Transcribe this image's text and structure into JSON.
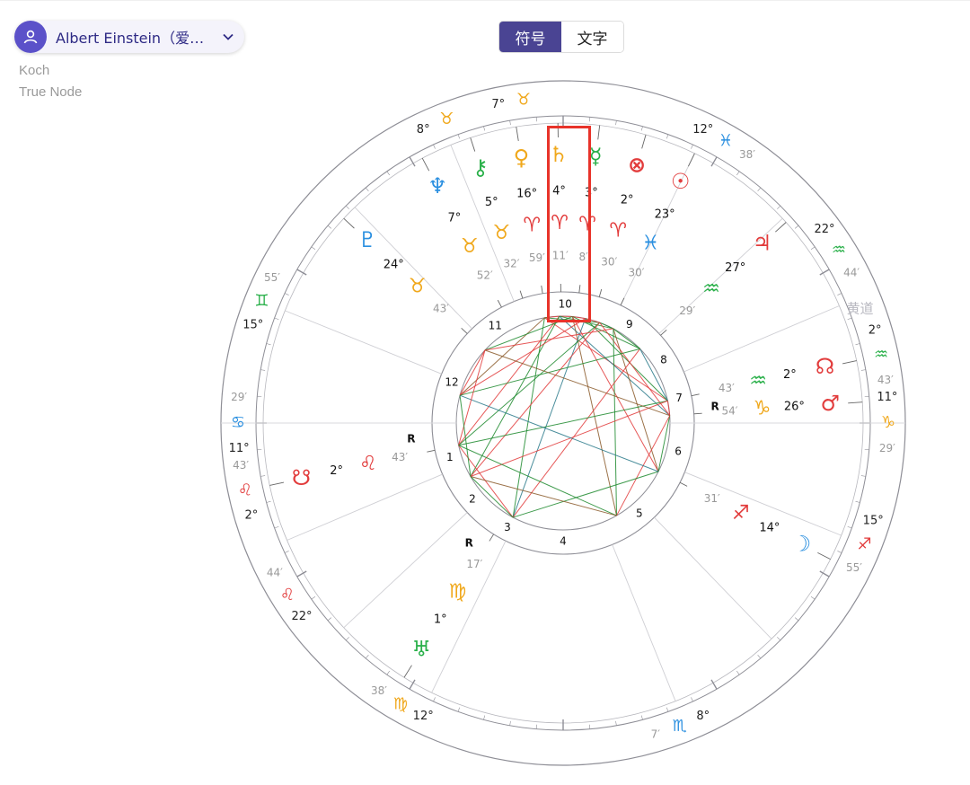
{
  "header": {
    "person_name": "Albert Einstein（爱因…",
    "house_system": "Koch",
    "node_type": "True Node",
    "tabs": [
      {
        "label": "符号",
        "active": true
      },
      {
        "label": "文字",
        "active": false
      }
    ]
  },
  "chart": {
    "ecliptic_label": "黄道",
    "outer_wheel": [
      {
        "deg": "7°",
        "min": "",
        "sign": "♉",
        "signColor": "#f0a81c",
        "ang": 97
      },
      {
        "deg": "12°",
        "min": "38′",
        "sign": "♓",
        "signColor": "#2a8fe0",
        "ang": 60
      },
      {
        "deg": "22°",
        "min": "44′",
        "sign": "♒",
        "signColor": "#2ab04a",
        "ang": 32
      },
      {
        "deg": "2°",
        "min": "43′",
        "sign": "♒",
        "signColor": "#2ab04a",
        "ang": 12
      },
      {
        "deg": "11°",
        "min": "29′",
        "sign": "♑",
        "signColor": "#f0a81c",
        "ang": 0
      },
      {
        "deg": "15°",
        "min": "55′",
        "sign": "♐",
        "signColor": "#e23c3c",
        "ang": -22
      },
      {
        "deg": "8°",
        "min": "7′",
        "sign": "♏",
        "signColor": "#2a8fe0",
        "ang": -69
      },
      {
        "deg": "12°",
        "min": "38′",
        "sign": "♍",
        "signColor": "#f0a81c",
        "ang": -120
      },
      {
        "deg": "22°",
        "min": "44′",
        "sign": "♌",
        "signColor": "#e23c3c",
        "ang": -148
      },
      {
        "deg": "2°",
        "min": "43′",
        "sign": "♌",
        "signColor": "#e23c3c",
        "ang": -168
      },
      {
        "deg": "11°",
        "min": "29′",
        "sign": "♋",
        "signColor": "#2a8fe0",
        "ang": -180
      },
      {
        "deg": "15°",
        "min": "55′",
        "sign": "♊",
        "signColor": "#2ab04a",
        "ang": 158
      },
      {
        "deg": "8°",
        "min": "",
        "sign": "♉",
        "signColor": "#f0a81c",
        "ang": 111
      }
    ],
    "planets": [
      {
        "name": "Neptune",
        "glyph": "♆",
        "color": "#2a8fe0",
        "deg": "7°",
        "sign": "♉",
        "signColor": "#f0a81c",
        "min": "52′",
        "ang": 118
      },
      {
        "name": "Chiron",
        "glyph": "⚷",
        "color": "#2ab04a",
        "deg": "5°",
        "sign": "♉",
        "signColor": "#f0a81c",
        "min": "32′",
        "ang": 108
      },
      {
        "name": "Venus",
        "glyph": "♀",
        "color": "#f0a81c",
        "deg": "16°",
        "sign": "♈",
        "signColor": "#e23c3c",
        "min": "59′",
        "ang": 99
      },
      {
        "name": "Saturn",
        "glyph": "♄",
        "color": "#f0a81c",
        "deg": "4°",
        "sign": "♈",
        "signColor": "#e23c3c",
        "min": "11′",
        "ang": 91
      },
      {
        "name": "Mercury",
        "glyph": "☿",
        "color": "#2ab04a",
        "deg": "3°",
        "sign": "♈",
        "signColor": "#e23c3c",
        "min": "8′",
        "ang": 83
      },
      {
        "name": "Part of Fortune",
        "glyph": "⊗",
        "color": "#e23c3c",
        "deg": "2°",
        "sign": "♈",
        "signColor": "#e23c3c",
        "min": "30′",
        "ang": 74
      },
      {
        "name": "Sun",
        "glyph": "☉",
        "color": "#e23c3c",
        "deg": "23°",
        "sign": "♓",
        "signColor": "#2a8fe0",
        "min": "30′",
        "ang": 64
      },
      {
        "name": "Jupiter",
        "glyph": "♃",
        "color": "#e23c3c",
        "deg": "27°",
        "sign": "♒",
        "signColor": "#2ab04a",
        "min": "29′",
        "ang": 42
      },
      {
        "name": "North Node",
        "glyph": "☊",
        "color": "#e23c3c",
        "deg": "2°",
        "sign": "♒",
        "signColor": "#2ab04a",
        "min": "43′",
        "ang": 12,
        "retro": true
      },
      {
        "name": "Mars",
        "glyph": "♂",
        "color": "#e23c3c",
        "deg": "26°",
        "sign": "♑",
        "signColor": "#f0a81c",
        "min": "54′",
        "ang": 4
      },
      {
        "name": "Moon",
        "glyph": "☽",
        "color": "#2a8fe0",
        "deg": "14°",
        "sign": "♐",
        "signColor": "#e23c3c",
        "min": "31′",
        "ang": -27
      },
      {
        "name": "Uranus",
        "glyph": "♅",
        "color": "#2ab04a",
        "deg": "1°",
        "sign": "♍",
        "signColor": "#f0a81c",
        "min": "17′",
        "ang": -122,
        "retro": true
      },
      {
        "name": "South Node",
        "glyph": "☋",
        "color": "#e23c3c",
        "deg": "2°",
        "sign": "♌",
        "signColor": "#e23c3c",
        "min": "43′",
        "ang": -168,
        "retro": true
      },
      {
        "name": "Pluto",
        "glyph": "♇",
        "color": "#2a8fe0",
        "deg": "24°",
        "sign": "♉",
        "signColor": "#f0a81c",
        "min": "43′",
        "ang": 137
      }
    ],
    "houses": [
      {
        "num": "1",
        "ang": -163
      },
      {
        "num": "2",
        "ang": -140
      },
      {
        "num": "3",
        "ang": -118
      },
      {
        "num": "4",
        "ang": -90
      },
      {
        "num": "5",
        "ang": -50
      },
      {
        "num": "6",
        "ang": -14
      },
      {
        "num": "7",
        "ang": 12
      },
      {
        "num": "8",
        "ang": 32
      },
      {
        "num": "9",
        "ang": 56
      },
      {
        "num": "10",
        "ang": 89
      },
      {
        "num": "11",
        "ang": 125
      },
      {
        "num": "12",
        "ang": 160
      }
    ],
    "house_cusps": [
      0,
      23,
      43,
      64,
      112,
      134,
      158,
      180,
      203,
      223,
      244,
      292,
      314,
      338
    ],
    "retro_label": "R",
    "highlight_planet": "Saturn",
    "colors": {
      "ring": "#8e8e96",
      "line": "#cfcfd4",
      "accent": "#4a4493",
      "highlight": "#e8332a"
    }
  }
}
